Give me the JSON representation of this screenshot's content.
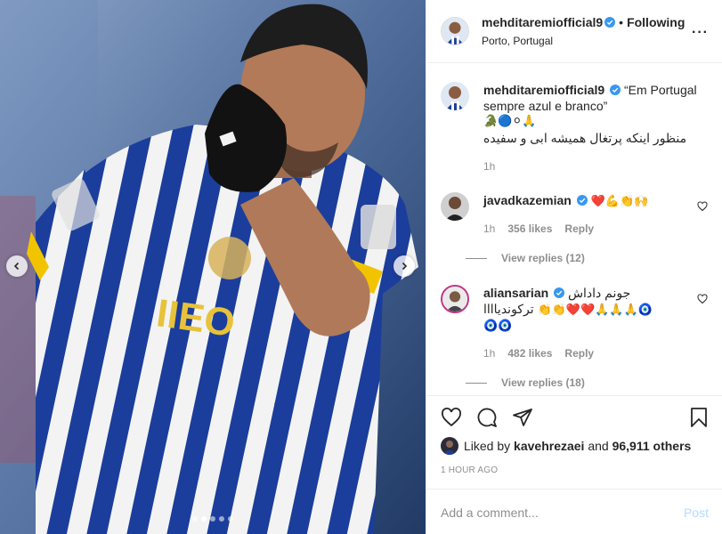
{
  "media": {
    "carousel_total": 5,
    "carousel_active": 1,
    "prev_icon": "chevron-left-icon",
    "next_icon": "chevron-right-icon"
  },
  "header": {
    "username": "mehditaremiofficial9",
    "separator": "•",
    "follow_label": "Following",
    "location": "Porto, Portugal",
    "more_icon": "more-horizontal-icon"
  },
  "caption": {
    "username": "mehditaremiofficial9",
    "text": "“Em Portugal sempre azul e branco”",
    "emojis": "🐊🔵⚪🙏",
    "persian": "منظور اینکه پرتغال همیشه ابی و سفیده",
    "time": "1h"
  },
  "comments": [
    {
      "username": "javadkazemian",
      "emojis": "❤️💪👏🙌",
      "time": "1h",
      "likes": "356 likes",
      "reply_label": "Reply",
      "view_replies": "View replies (12)"
    },
    {
      "username": "aliansarian",
      "text": "جونم داداش",
      "text2": "ترکوندیاااا",
      "emojis": "👏👏❤️❤️🙏🙏🙏🧿",
      "emojis2": "🧿🧿",
      "time": "1h",
      "likes": "482 likes",
      "reply_label": "Reply",
      "view_replies": "View replies (18)"
    }
  ],
  "actions": {
    "like_icon": "heart-icon",
    "comment_icon": "comment-icon",
    "share_icon": "share-icon",
    "save_icon": "bookmark-icon"
  },
  "likes": {
    "prefix": "Liked by",
    "liker": "kavehrezaei",
    "conj": "and",
    "count": "96,911 others"
  },
  "timestamp": "1 HOUR AGO",
  "add_comment": {
    "placeholder": "Add a comment...",
    "post_label": "Post"
  },
  "colors": {
    "jersey_blue": "#1a3c9e",
    "jersey_white": "#f2f2f2",
    "armband_yellow": "#f2c400",
    "verified_blue": "#3897f0",
    "post_blue": "#b3dbff"
  }
}
